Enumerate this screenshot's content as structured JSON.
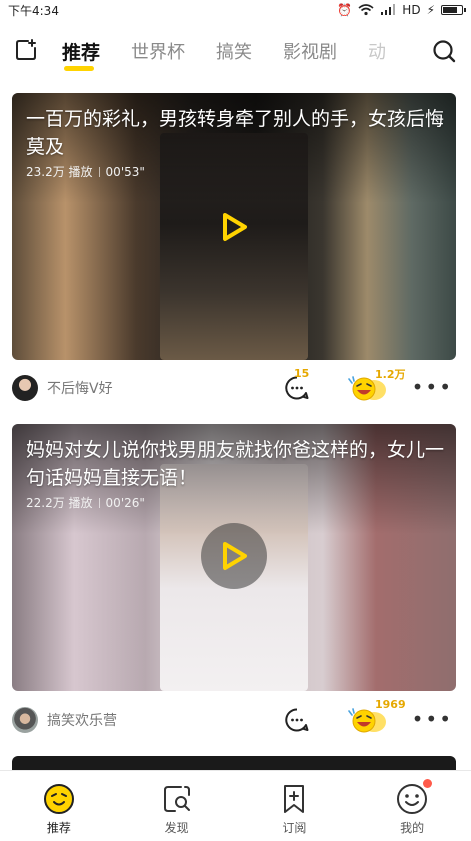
{
  "status_bar": {
    "time": "下午4:34",
    "network": "HD",
    "battery_level": 0.85
  },
  "top_nav": {
    "tabs": [
      {
        "label": "推荐",
        "active": true
      },
      {
        "label": "世界杯",
        "active": false
      },
      {
        "label": "搞笑",
        "active": false
      },
      {
        "label": "影视剧",
        "active": false
      },
      {
        "label": "动",
        "active": false
      }
    ]
  },
  "feed": [
    {
      "title": "一百万的彩礼，男孩转身牵了别人的手，女孩后悔莫及",
      "plays": "23.2万 播放",
      "duration": "00'53\"",
      "author": "不后悔V好",
      "comment_count": "15",
      "like_count": "1.2万"
    },
    {
      "title": "妈妈对女儿说你找男朋友就找你爸这样的，女儿一句话妈妈直接无语！",
      "plays": "22.2万 播放",
      "duration": "00'26\"",
      "author": "搞笑欢乐营",
      "comment_count": "",
      "like_count": "1969"
    }
  ],
  "bottom_nav": [
    {
      "label": "推荐",
      "icon": "home-face-icon",
      "active": true
    },
    {
      "label": "发现",
      "icon": "discover-icon",
      "active": false
    },
    {
      "label": "订阅",
      "icon": "subscribe-icon",
      "active": false
    },
    {
      "label": "我的",
      "icon": "profile-icon",
      "active": false,
      "badge": true
    }
  ],
  "colors": {
    "accent": "#ffd300",
    "count": "#e6a800",
    "badge": "#ff5a4a"
  }
}
